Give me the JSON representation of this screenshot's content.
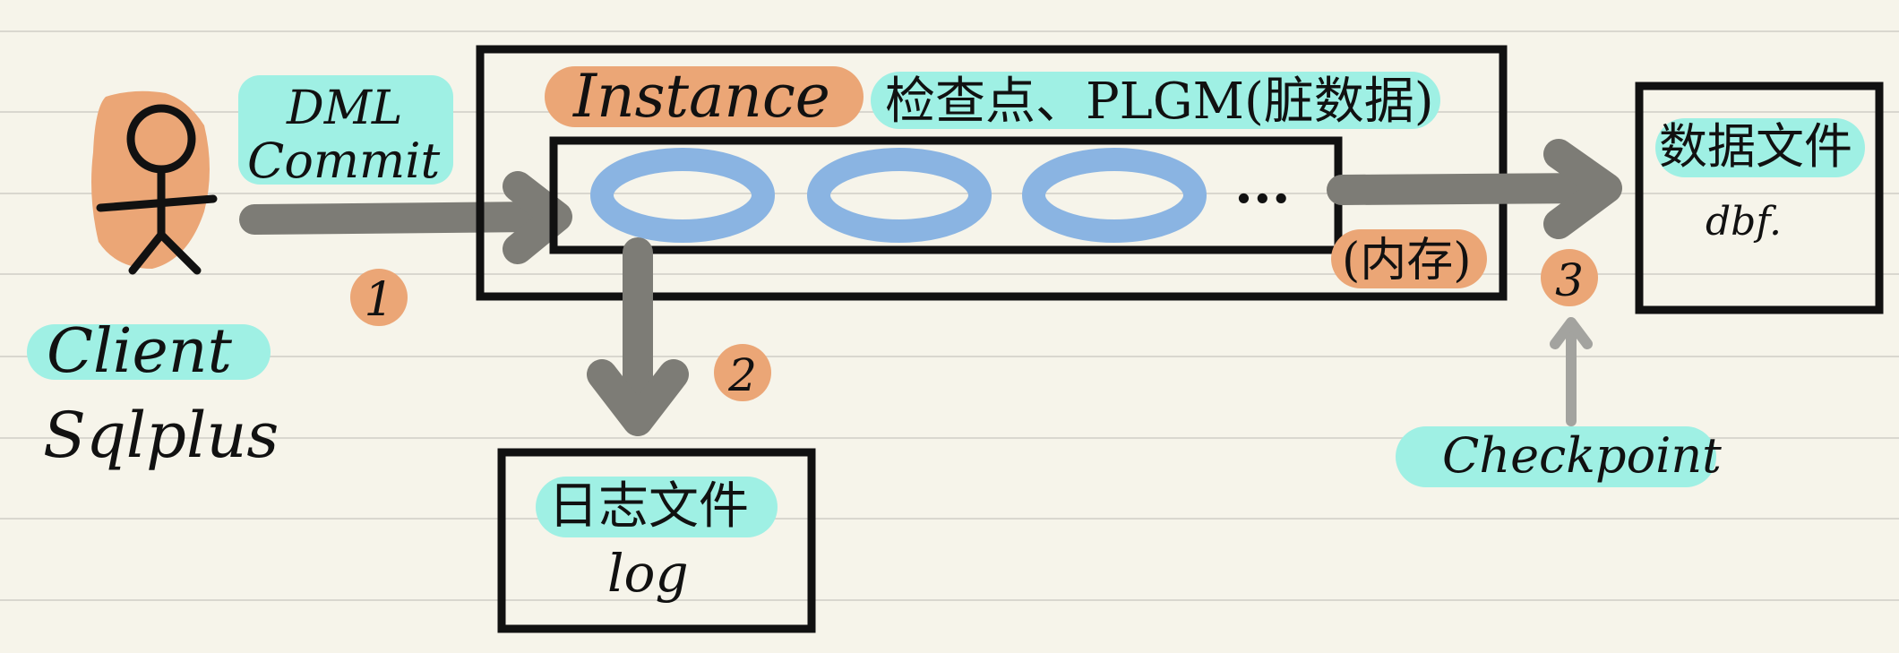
{
  "client": {
    "label": "Client",
    "sublabel": "Sqlplus"
  },
  "dml": {
    "line1": "DML",
    "line2": "Commit"
  },
  "instance": {
    "label": "Instance",
    "note": "检查点、PLGM(脏数据)"
  },
  "memory": {
    "label": "(内存)",
    "ellipsis": "..."
  },
  "steps": {
    "one": "1",
    "two": "2",
    "three": "3"
  },
  "log_file": {
    "title": "日志文件",
    "ext": "log"
  },
  "data_file": {
    "title": "数据文件",
    "ext": "dbf."
  },
  "checkpoint": {
    "label": "Checkpoint"
  },
  "colors": {
    "orange": "#eba676",
    "teal": "#9ff0e4",
    "blue": "#8ab4e2",
    "arrow": "#7d7c76",
    "arrow_light": "#a3a39f",
    "paper": "#f6f4ea"
  }
}
